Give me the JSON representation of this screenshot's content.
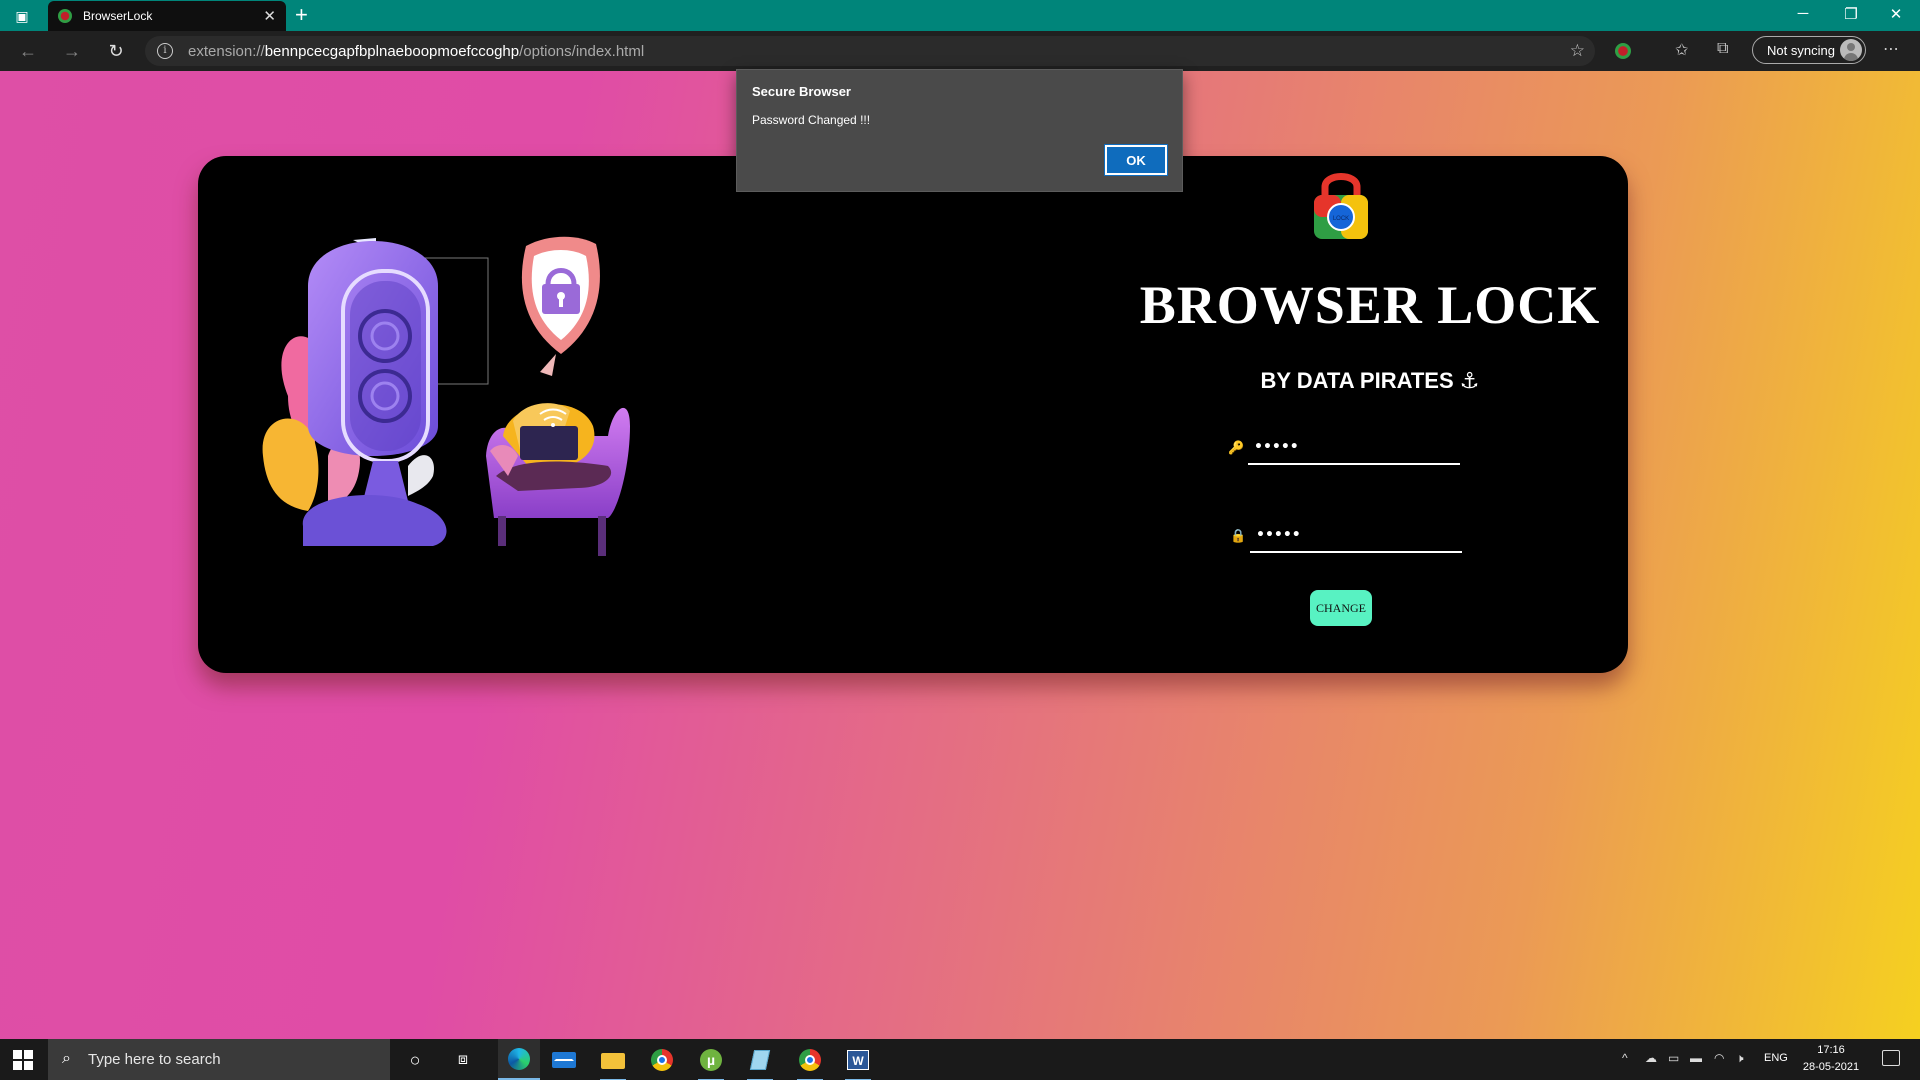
{
  "browser": {
    "tab_title": "BrowserLock",
    "url_scheme": "extension://",
    "url_host": "bennpcecgapfbplnaeboopmoefccoghp",
    "url_path": "/options/index.html",
    "sync_label": "Not syncing"
  },
  "page": {
    "heading": "BROWSER LOCK",
    "byline": "BY DATA PIRATES ⚓",
    "logo_text": "LOCK",
    "old_password_value": "•••••",
    "new_password_value": "•••••",
    "change_label": "CHANGE"
  },
  "dialog": {
    "title": "Secure Browser",
    "message": "Password Changed !!!",
    "ok_label": "OK"
  },
  "taskbar": {
    "search_placeholder": "Type here to search",
    "lang": "ENG",
    "time": "17:16",
    "date": "28-05-2021"
  },
  "colors": {
    "titlebar": "#00857a",
    "accent_button": "#58f2c2",
    "dialog_ok": "#0f6cbd",
    "gradient_start": "#de4fa6",
    "gradient_end": "#f5d020"
  }
}
